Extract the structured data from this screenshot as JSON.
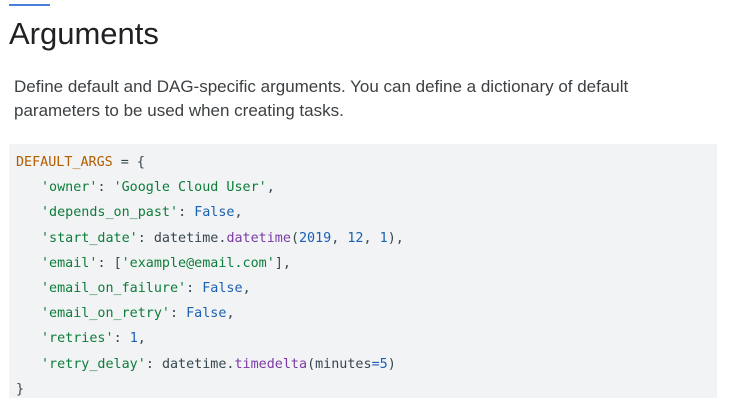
{
  "accent_color": "#4a7fe0",
  "heading": "Arguments",
  "description": "Define default and DAG-specific arguments. You can define a dictionary of default parameters to be used when creating tasks.",
  "code": {
    "var_name": "DEFAULT_ARGS",
    "assign": " = {",
    "lines": [
      {
        "key": "'owner'",
        "sep": ": ",
        "value": "'Google Cloud User'",
        "end": ","
      },
      {
        "key": "'depends_on_past'",
        "sep": ": ",
        "value": "False",
        "end": ","
      },
      {
        "key": "'start_date'",
        "sep": ": ",
        "obj": "datetime.",
        "func": "datetime",
        "open": "(",
        "a1": "2019",
        "c1": ", ",
        "a2": "12",
        "c2": ", ",
        "a3": "1",
        "close": "),"
      },
      {
        "key": "'email'",
        "sep": ": ",
        "open": "[",
        "value": "'example@email.com'",
        "close": "],"
      },
      {
        "key": "'email_on_failure'",
        "sep": ": ",
        "value": "False",
        "end": ","
      },
      {
        "key": "'email_on_retry'",
        "sep": ": ",
        "value": "False",
        "end": ","
      },
      {
        "key": "'retries'",
        "sep": ": ",
        "value": "1",
        "end": ","
      },
      {
        "key": "'retry_delay'",
        "sep": ": ",
        "obj": "datetime.",
        "func": "timedelta",
        "open": "(",
        "param": "minutes",
        "eq": "=",
        "num": "5",
        "close": ")"
      }
    ],
    "closing": "}"
  }
}
